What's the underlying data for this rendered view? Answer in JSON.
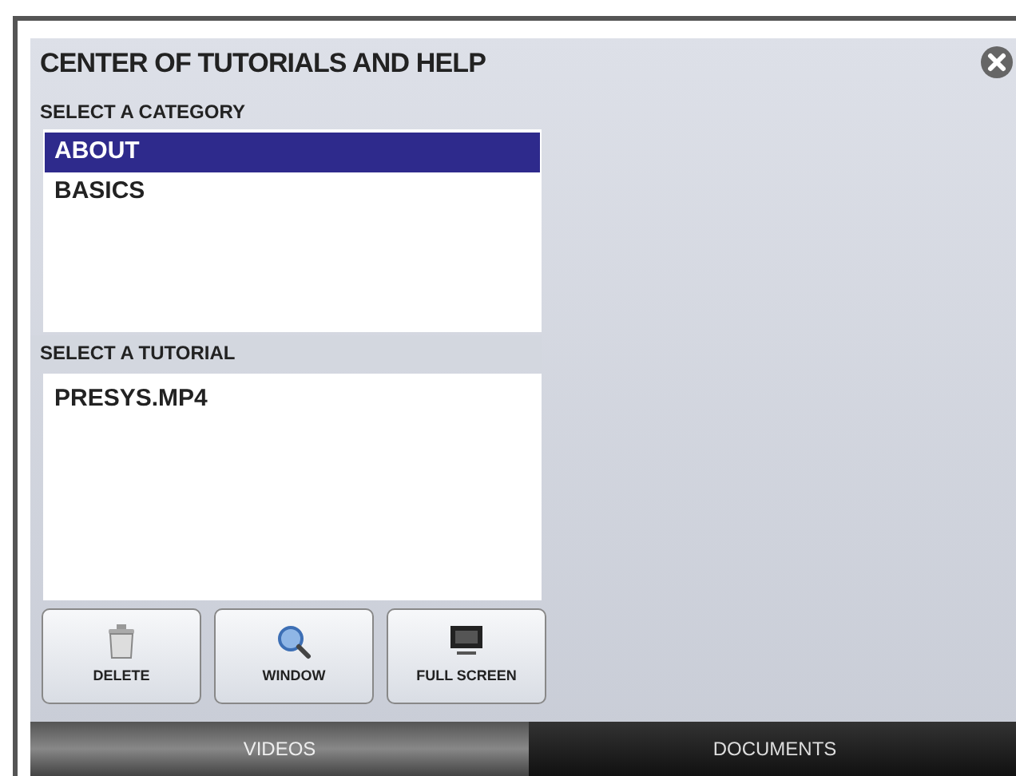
{
  "window": {
    "title": "CENTER OF TUTORIALS AND HELP"
  },
  "categories": {
    "label": "SELECT A CATEGORY",
    "items": [
      {
        "label": "ABOUT",
        "selected": true
      },
      {
        "label": "BASICS",
        "selected": false
      }
    ]
  },
  "tutorials": {
    "label": "SELECT A TUTORIAL",
    "items": [
      {
        "label": "PRESYS.MP4",
        "selected": false
      }
    ]
  },
  "buttons": [
    {
      "kind": "delete",
      "label": "DELETE"
    },
    {
      "kind": "window",
      "label": "WINDOW"
    },
    {
      "kind": "fullscreen",
      "label": "FULL SCREEN"
    }
  ],
  "tabs": [
    {
      "label": "VIDEOS",
      "selected": true
    },
    {
      "label": "DOCUMENTS",
      "selected": false
    }
  ]
}
